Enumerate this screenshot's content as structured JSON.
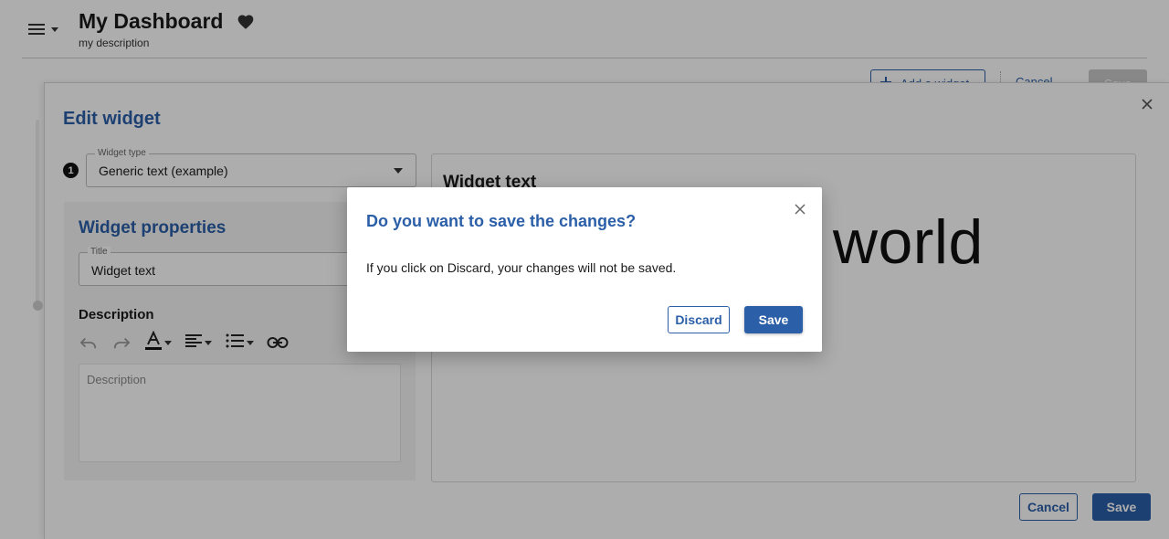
{
  "header": {
    "title": "My Dashboard",
    "description": "my description",
    "add_widget_label": "Add a widget",
    "cancel_label": "Cancel",
    "save_label": "Save"
  },
  "edit_panel": {
    "title": "Edit widget",
    "widget_type": {
      "label": "Widget type",
      "value": "Generic text (example)"
    },
    "step_number": "1",
    "properties": {
      "title": "Widget properties",
      "title_field": {
        "label": "Title",
        "value": "Widget text"
      },
      "description_label": "Description",
      "description_placeholder": "Description"
    },
    "preview": {
      "title": "Widget text",
      "content": "Hello world"
    },
    "cancel_label": "Cancel",
    "save_label": "Save"
  },
  "dialog": {
    "title": "Do you want to save the changes?",
    "body": "If you click on Discard, your changes will not be saved.",
    "discard_label": "Discard",
    "save_label": "Save"
  },
  "colors": {
    "accent": "#2b5fa8",
    "overlay": "rgba(0,0,0,0.32)"
  },
  "icons": [
    "menu-icon",
    "heart-icon",
    "plus-icon",
    "close-icon",
    "undo-icon",
    "redo-icon",
    "text-color-icon",
    "align-left-icon",
    "bulleted-list-icon",
    "link-icon",
    "chevron-down-icon"
  ]
}
